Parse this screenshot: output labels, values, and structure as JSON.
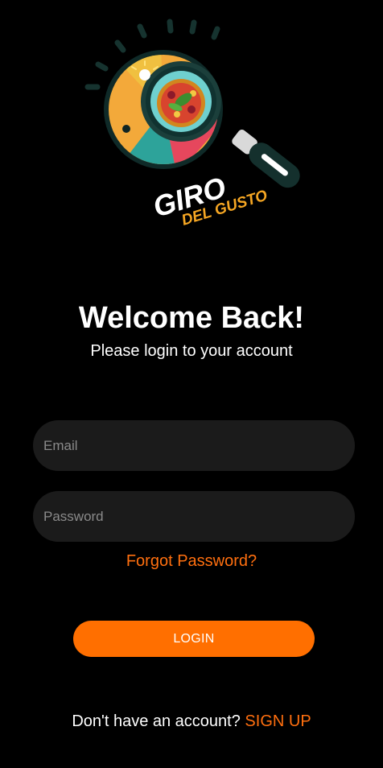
{
  "logo": {
    "text_line1": "GIRO",
    "text_line2": "DEL GUSTO"
  },
  "heading": {
    "title": "Welcome Back!",
    "subtitle": "Please login to your account"
  },
  "form": {
    "email_placeholder": "Email",
    "password_placeholder": "Password",
    "forgot_label": "Forgot Password?",
    "login_label": "LOGIN"
  },
  "footer": {
    "prompt": "Don't have an account?",
    "signup_label": "SIGN UP"
  },
  "colors": {
    "background": "#000000",
    "accent": "#ff6f00",
    "field": "#1b1b1b"
  }
}
